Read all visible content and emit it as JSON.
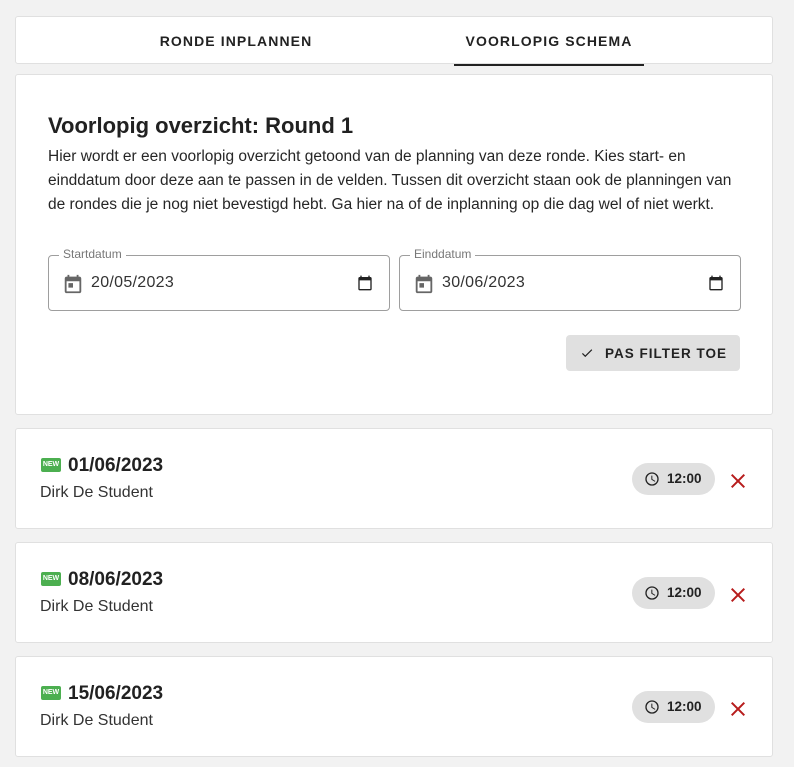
{
  "tabs": [
    {
      "label": "RONDE INPLANNEN",
      "active": false
    },
    {
      "label": "VOORLOPIG SCHEMA",
      "active": true
    }
  ],
  "overview": {
    "title": "Voorlopig overzicht: Round 1",
    "description": "Hier wordt er een voorlopig overzicht getoond van de planning van deze ronde. Kies start- en einddatum door deze aan te passen in de velden. Tussen dit overzicht staan ook de planningen van de rondes die je nog niet bevestigd hebt. Ga hier na of de inplanning op die dag wel of niet werkt.",
    "start_field": {
      "label": "Startdatum",
      "value": "20/05/2023"
    },
    "end_field": {
      "label": "Einddatum",
      "value": "30/06/2023"
    },
    "apply_button": "PAS FILTER TOE"
  },
  "items": [
    {
      "badge": "NEW",
      "date": "01/06/2023",
      "student": "Dirk De Student",
      "time": "12:00"
    },
    {
      "badge": "NEW",
      "date": "08/06/2023",
      "student": "Dirk De Student",
      "time": "12:00"
    },
    {
      "badge": "NEW",
      "date": "15/06/2023",
      "student": "Dirk De Student",
      "time": "12:00"
    }
  ],
  "colors": {
    "new_badge": "#4caf50",
    "delete": "#b71c1c",
    "chip": "#e0e0e0"
  },
  "icons": [
    "calendar-icon",
    "date-picker-icon",
    "check-icon",
    "new-icon",
    "clock-icon",
    "close-icon"
  ]
}
